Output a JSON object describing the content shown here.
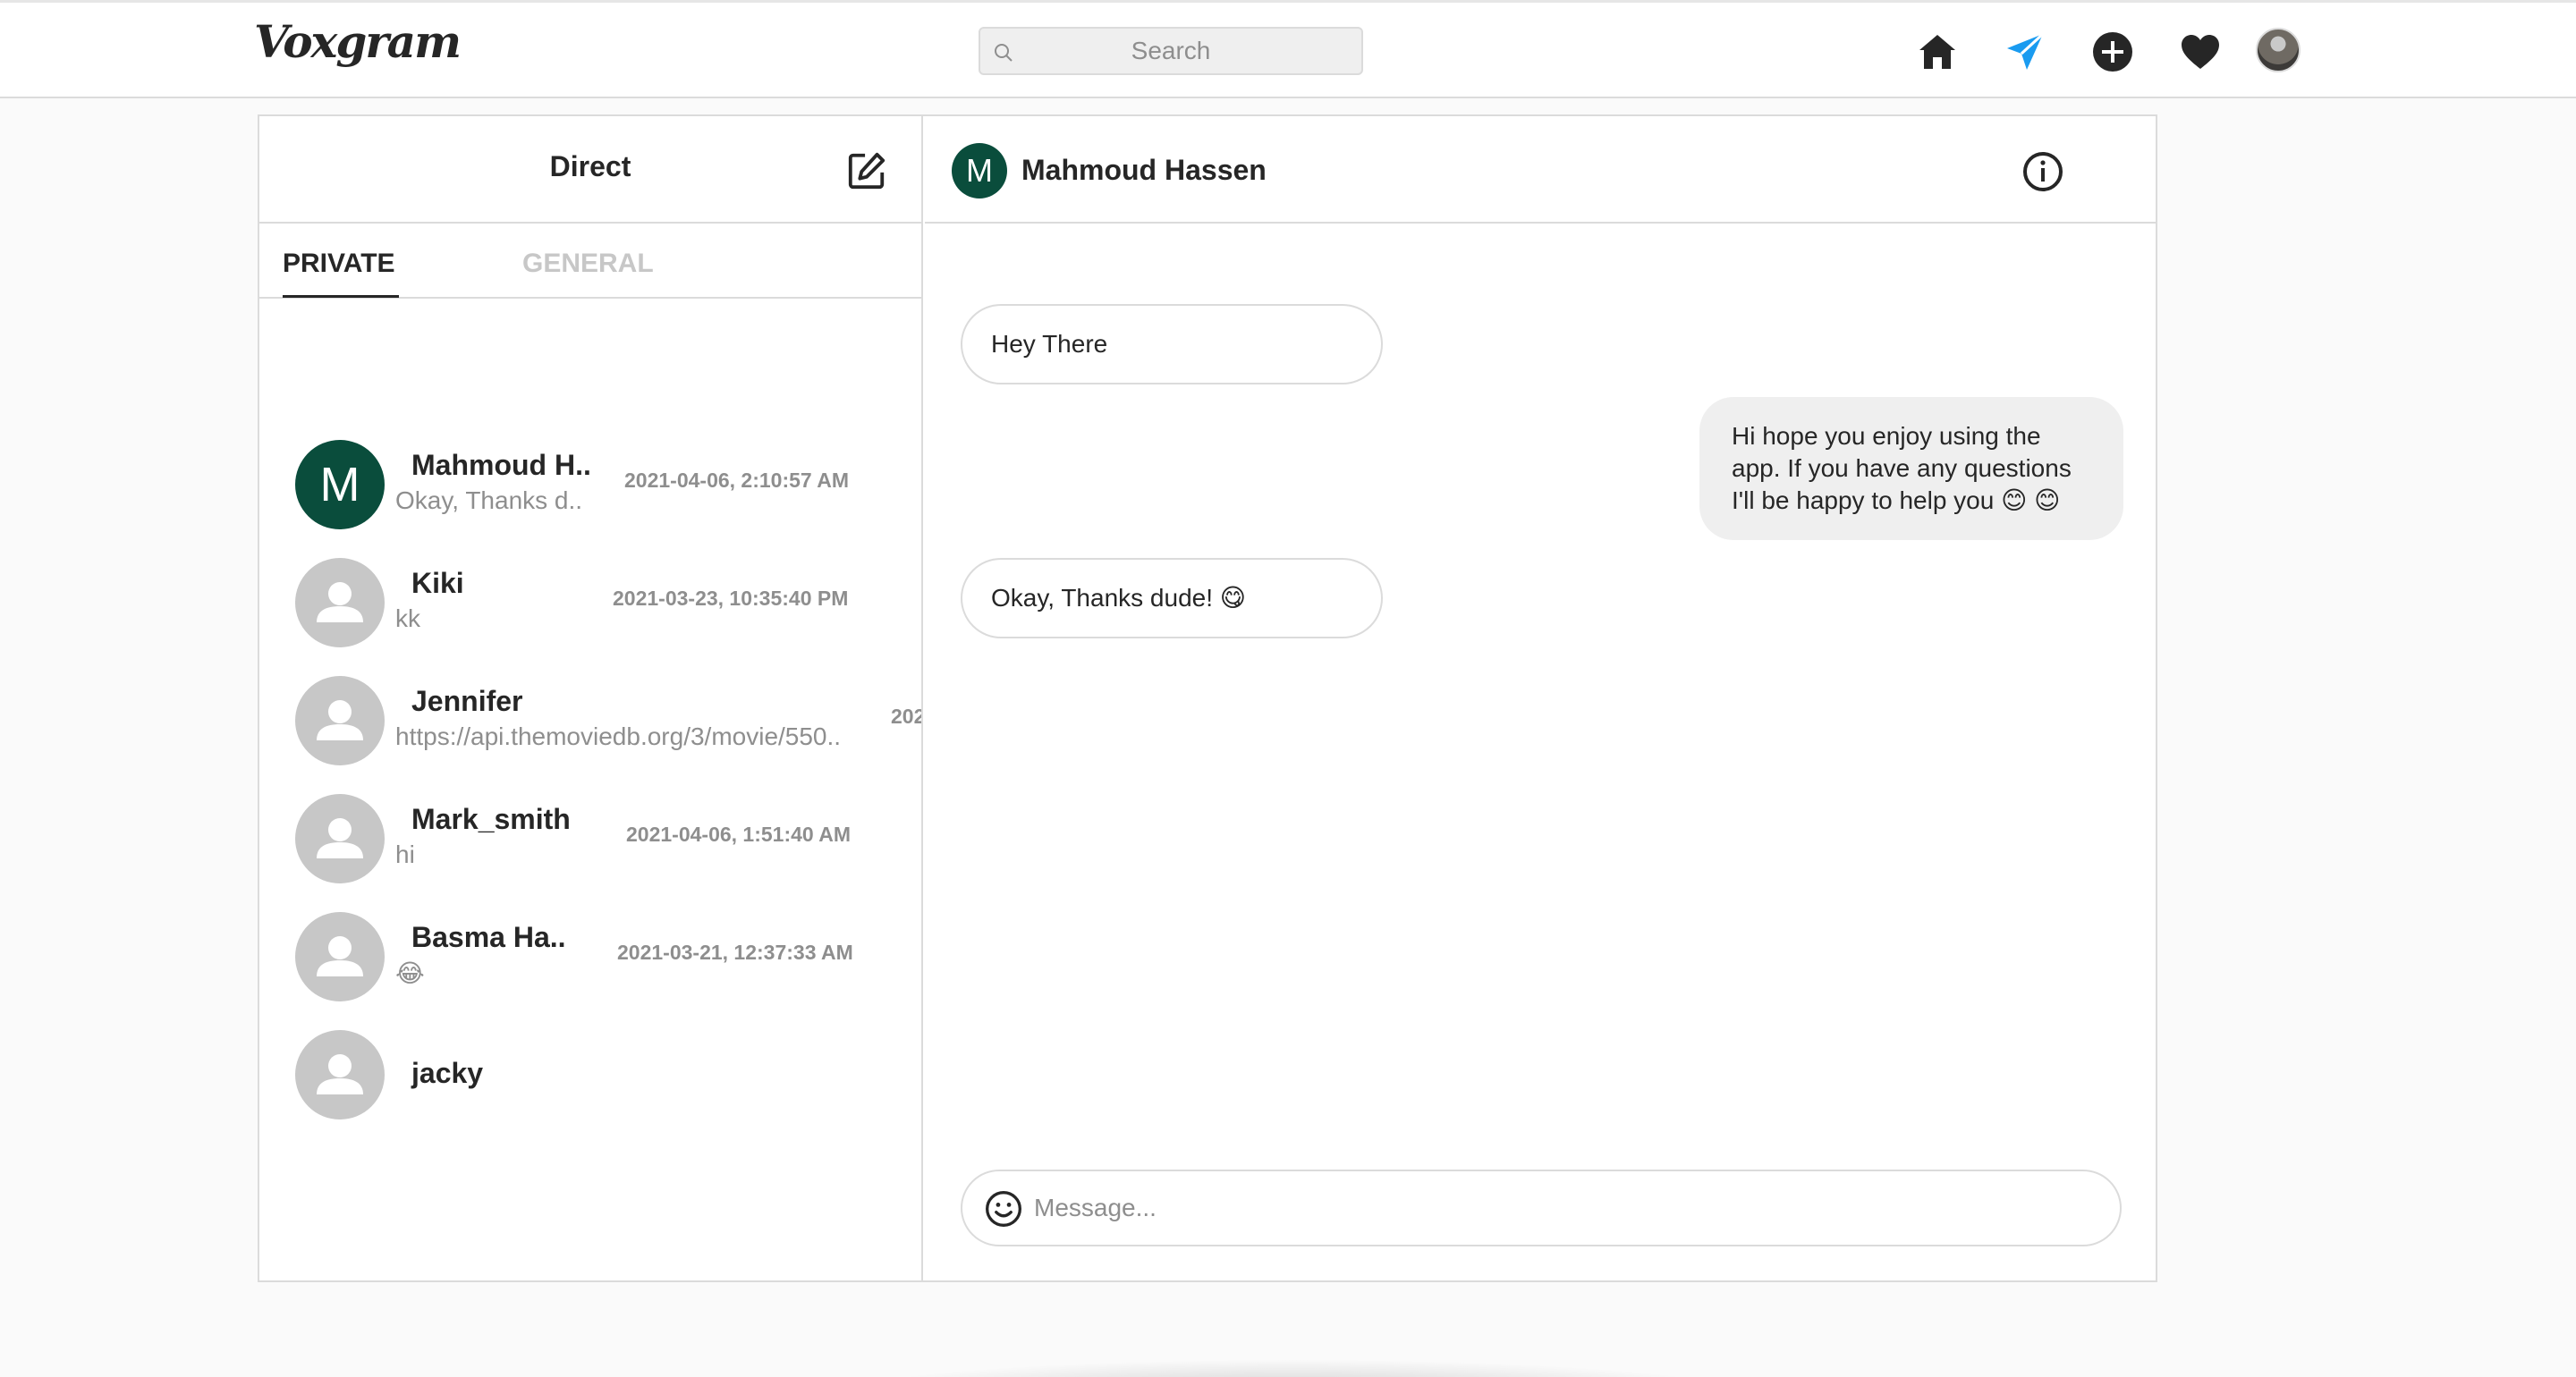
{
  "brand": {
    "logo_text": "Voxgram"
  },
  "search": {
    "placeholder": "Search"
  },
  "nav": {
    "icons": [
      "home-icon",
      "direct-icon",
      "new-post-icon",
      "activity-icon",
      "profile-avatar"
    ],
    "active": "direct-icon",
    "accent": "#1a9bf0"
  },
  "inbox": {
    "title": "Direct",
    "tabs": [
      {
        "label": "PRIVATE",
        "active": true
      },
      {
        "label": "GENERAL",
        "active": false
      }
    ],
    "conversations": [
      {
        "name": "Mahmoud H..",
        "last": "Okay, Thanks d..",
        "time": "2021-04-06, 2:10:57 AM",
        "avatar": "M"
      },
      {
        "name": "Kiki",
        "last": "kk",
        "time": "2021-03-23, 10:35:40 PM",
        "avatar": ""
      },
      {
        "name": "Jennifer",
        "last": "https://api.themoviedb.org/3/movie/550..",
        "time": "202",
        "avatar": ""
      },
      {
        "name": "Mark_smith",
        "last": "hi",
        "time": "2021-04-06, 1:51:40 AM",
        "avatar": ""
      },
      {
        "name": "Basma Ha..",
        "last": "😂",
        "time": "2021-03-21, 12:37:33 AM",
        "avatar": ""
      },
      {
        "name": "jacky",
        "last": "",
        "time": "",
        "avatar": ""
      }
    ]
  },
  "chat": {
    "contact": {
      "initial": "M",
      "name": "Mahmoud Hassen"
    },
    "messages": [
      {
        "direction": "incoming",
        "text": "Hey There"
      },
      {
        "direction": "outgoing",
        "text": "Hi hope you enjoy using the app. If you have any questions I'll be happy to help you 😊 😊"
      },
      {
        "direction": "incoming",
        "text": "Okay, Thanks dude! 😋"
      }
    ],
    "composer": {
      "placeholder": "Message..."
    }
  }
}
